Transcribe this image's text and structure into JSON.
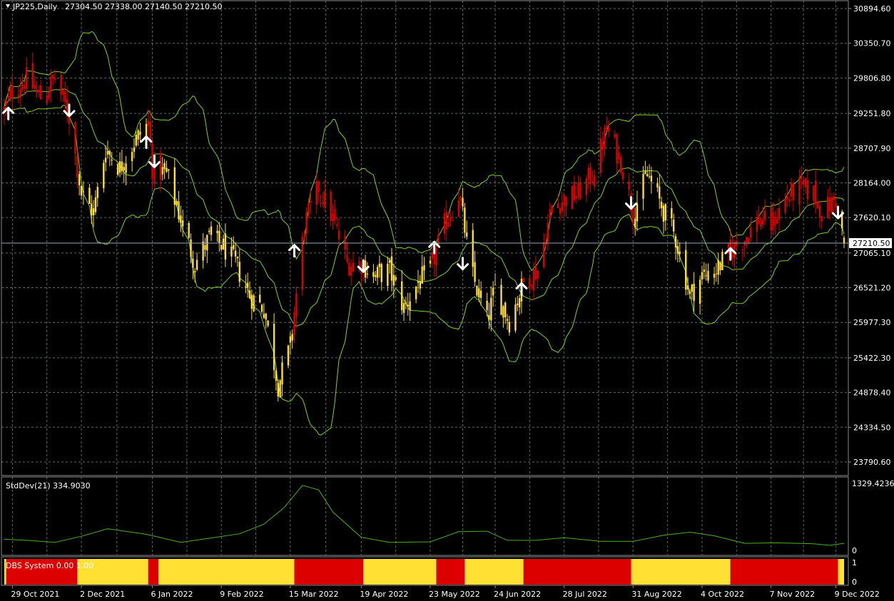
{
  "header": {
    "symbol": "JP225,Daily",
    "open": "27304.50",
    "high": "27338.00",
    "low": "27140.50",
    "close": "27210.50"
  },
  "current_price_label": "27210.50",
  "colors": {
    "background": "#000000",
    "grid": "#5a6a6a",
    "bull_candle": "#ffe033",
    "bear_candle": "#dd0000",
    "bands": "#7ed321",
    "stddev_line": "#4caf1a",
    "arrows": "#ffffff"
  },
  "price_axis": [
    "30894.60",
    "30350.70",
    "29806.80",
    "29251.80",
    "28707.90",
    "28164.00",
    "27620.10",
    "27065.10",
    "26521.20",
    "25977.30",
    "25422.30",
    "24878.40",
    "24334.50",
    "23790.60"
  ],
  "stddev": {
    "label": "StdDev(21) 334.9030",
    "axis_max": "1329.4236",
    "axis_min": "0"
  },
  "dbs": {
    "label": "DBS System 0.00 1.00",
    "axis_max": "1",
    "axis_min": "0"
  },
  "date_axis": [
    "29 Oct 2021",
    "2 Dec 2021",
    "6 Jan 2022",
    "9 Feb 2022",
    "15 Mar 2022",
    "19 Apr 2022",
    "23 May 2022",
    "24 Jun 2022",
    "28 Jul 2022",
    "31 Aug 2022",
    "4 Oct 2022",
    "7 Nov 2022",
    "9 Dec 2022"
  ],
  "chart_data": {
    "type": "candlestick",
    "x_start": "2021-10-25",
    "x_end": "2022-12-13",
    "ylim": [
      23500,
      31100
    ],
    "price_path": [
      [
        "2021-10-25",
        29300
      ],
      [
        "2021-10-29",
        29600
      ],
      [
        "2021-11-05",
        29800
      ],
      [
        "2021-11-12",
        29500
      ],
      [
        "2021-11-19",
        29800
      ],
      [
        "2021-11-26",
        29200
      ],
      [
        "2021-12-02",
        28000
      ],
      [
        "2021-12-08",
        27700
      ],
      [
        "2021-12-14",
        28700
      ],
      [
        "2021-12-21",
        28400
      ],
      [
        "2021-12-28",
        28800
      ],
      [
        "2022-01-04",
        29100
      ],
      [
        "2022-01-06",
        28400
      ],
      [
        "2022-01-13",
        28300
      ],
      [
        "2022-01-20",
        27600
      ],
      [
        "2022-01-27",
        26900
      ],
      [
        "2022-02-03",
        27300
      ],
      [
        "2022-02-09",
        27200
      ],
      [
        "2022-02-16",
        26900
      ],
      [
        "2022-02-23",
        26400
      ],
      [
        "2022-03-02",
        26200
      ],
      [
        "2022-03-09",
        25000
      ],
      [
        "2022-03-15",
        25600
      ],
      [
        "2022-03-22",
        27500
      ],
      [
        "2022-03-29",
        28100
      ],
      [
        "2022-04-05",
        27600
      ],
      [
        "2022-04-12",
        26900
      ],
      [
        "2022-04-19",
        26900
      ],
      [
        "2022-04-26",
        26700
      ],
      [
        "2022-05-03",
        26800
      ],
      [
        "2022-05-10",
        26200
      ],
      [
        "2022-05-17",
        26600
      ],
      [
        "2022-05-23",
        26800
      ],
      [
        "2022-05-30",
        27500
      ],
      [
        "2022-06-06",
        28000
      ],
      [
        "2022-06-13",
        26700
      ],
      [
        "2022-06-20",
        26000
      ],
      [
        "2022-06-24",
        26500
      ],
      [
        "2022-07-01",
        26000
      ],
      [
        "2022-07-08",
        26600
      ],
      [
        "2022-07-15",
        26800
      ],
      [
        "2022-07-22",
        27800
      ],
      [
        "2022-07-28",
        27900
      ],
      [
        "2022-08-04",
        28000
      ],
      [
        "2022-08-11",
        28300
      ],
      [
        "2022-08-18",
        29000
      ],
      [
        "2022-08-25",
        28500
      ],
      [
        "2022-08-31",
        27700
      ],
      [
        "2022-09-07",
        28300
      ],
      [
        "2022-09-14",
        27800
      ],
      [
        "2022-09-21",
        27300
      ],
      [
        "2022-09-28",
        26400
      ],
      [
        "2022-10-04",
        26700
      ],
      [
        "2022-10-11",
        26800
      ],
      [
        "2022-10-18",
        27100
      ],
      [
        "2022-10-25",
        27300
      ],
      [
        "2022-11-01",
        27600
      ],
      [
        "2022-11-07",
        27500
      ],
      [
        "2022-11-14",
        27900
      ],
      [
        "2022-11-21",
        28100
      ],
      [
        "2022-11-28",
        28000
      ],
      [
        "2022-12-02",
        27700
      ],
      [
        "2022-12-09",
        27900
      ],
      [
        "2022-12-13",
        27210.5
      ]
    ],
    "bear_periods": [
      [
        "2021-10-25",
        "2021-11-30"
      ],
      [
        "2022-01-04",
        "2022-01-10"
      ],
      [
        "2022-03-17",
        "2022-04-20"
      ],
      [
        "2022-05-24",
        "2022-06-07"
      ],
      [
        "2022-07-08",
        "2022-08-31"
      ],
      [
        "2022-10-17",
        "2022-12-10"
      ]
    ],
    "signals": [
      {
        "date": "2021-10-27",
        "dir": "up",
        "price": 29250
      },
      {
        "date": "2021-11-26",
        "dir": "down",
        "price": 29300
      },
      {
        "date": "2022-01-03",
        "dir": "up",
        "price": 28800
      },
      {
        "date": "2022-01-07",
        "dir": "down",
        "price": 28500
      },
      {
        "date": "2022-03-17",
        "dir": "up",
        "price": 27100
      },
      {
        "date": "2022-04-20",
        "dir": "down",
        "price": 26860
      },
      {
        "date": "2022-05-25",
        "dir": "up",
        "price": 27150
      },
      {
        "date": "2022-06-08",
        "dir": "down",
        "price": 26900
      },
      {
        "date": "2022-07-07",
        "dir": "up",
        "price": 26500
      },
      {
        "date": "2022-08-30",
        "dir": "down",
        "price": 27850
      },
      {
        "date": "2022-10-18",
        "dir": "up",
        "price": 27050
      },
      {
        "date": "2022-12-10",
        "dir": "down",
        "price": 27700
      }
    ],
    "dbs_segments": [
      [
        "2021-10-25",
        "2021-10-26",
        "yellow"
      ],
      [
        "2021-10-26",
        "2021-11-30",
        "red"
      ],
      [
        "2021-11-30",
        "2022-01-04",
        "yellow"
      ],
      [
        "2022-01-04",
        "2022-01-09",
        "red"
      ],
      [
        "2022-01-09",
        "2022-03-17",
        "yellow"
      ],
      [
        "2022-03-17",
        "2022-04-20",
        "red"
      ],
      [
        "2022-04-20",
        "2022-05-26",
        "yellow"
      ],
      [
        "2022-05-26",
        "2022-06-09",
        "red"
      ],
      [
        "2022-06-09",
        "2022-07-08",
        "yellow"
      ],
      [
        "2022-07-08",
        "2022-08-30",
        "red"
      ],
      [
        "2022-08-30",
        "2022-10-18",
        "yellow"
      ],
      [
        "2022-10-18",
        "2022-12-10",
        "red"
      ],
      [
        "2022-12-10",
        "2022-12-13",
        "yellow"
      ]
    ],
    "stddev_ylim": [
      0,
      1329.4236
    ],
    "stddev_path": [
      [
        "2021-10-25",
        220
      ],
      [
        "2021-11-05",
        200
      ],
      [
        "2021-11-19",
        160
      ],
      [
        "2021-12-02",
        280
      ],
      [
        "2021-12-15",
        430
      ],
      [
        "2022-01-03",
        320
      ],
      [
        "2022-01-20",
        160
      ],
      [
        "2022-02-03",
        240
      ],
      [
        "2022-02-18",
        330
      ],
      [
        "2022-03-02",
        520
      ],
      [
        "2022-03-12",
        850
      ],
      [
        "2022-03-21",
        1290
      ],
      [
        "2022-03-29",
        1200
      ],
      [
        "2022-04-05",
        760
      ],
      [
        "2022-04-19",
        260
      ],
      [
        "2022-05-03",
        160
      ],
      [
        "2022-05-23",
        170
      ],
      [
        "2022-06-06",
        370
      ],
      [
        "2022-06-20",
        380
      ],
      [
        "2022-06-30",
        200
      ],
      [
        "2022-07-14",
        200
      ],
      [
        "2022-07-28",
        250
      ],
      [
        "2022-08-15",
        180
      ],
      [
        "2022-08-31",
        180
      ],
      [
        "2022-09-15",
        300
      ],
      [
        "2022-09-28",
        360
      ],
      [
        "2022-10-10",
        290
      ],
      [
        "2022-10-25",
        140
      ],
      [
        "2022-11-10",
        150
      ],
      [
        "2022-11-28",
        130
      ],
      [
        "2022-12-06",
        100
      ],
      [
        "2022-12-13",
        140
      ]
    ],
    "bands_note": "Bollinger-style envelope (middle, upper, lower)"
  }
}
